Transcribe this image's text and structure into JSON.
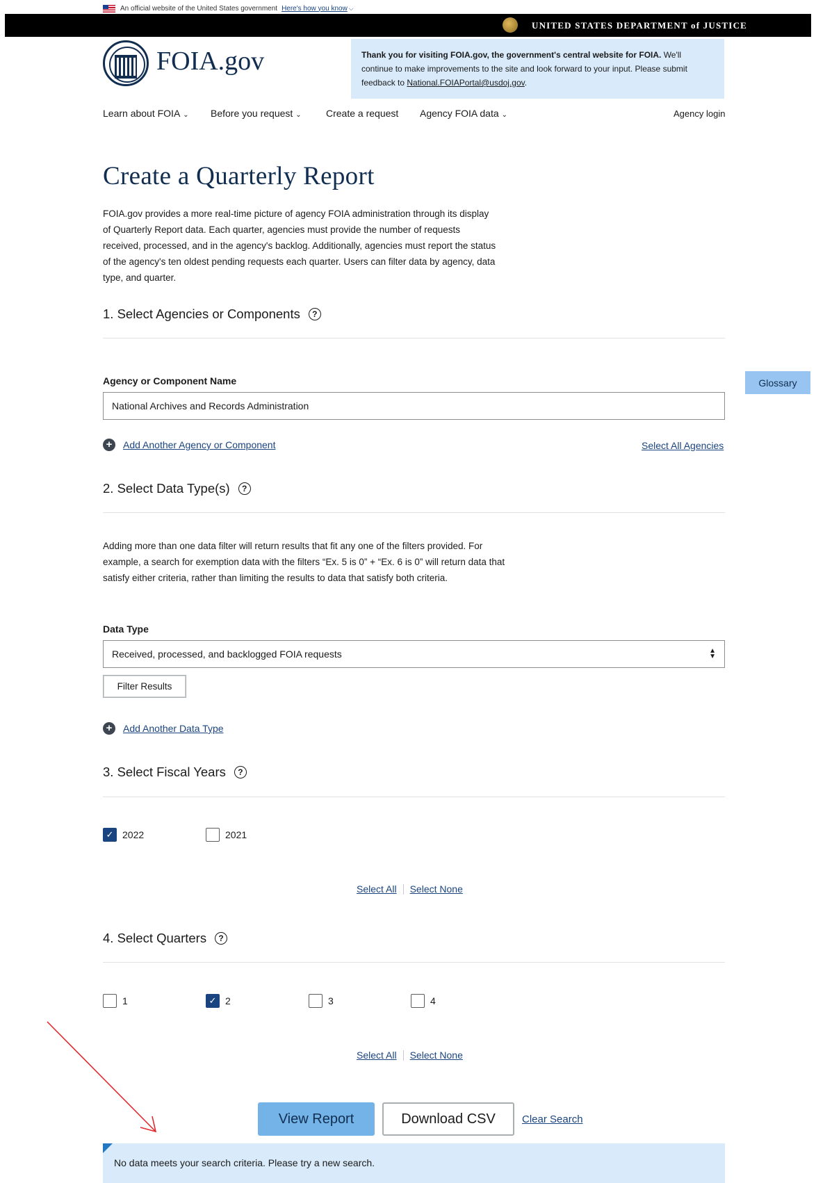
{
  "gov_banner": {
    "text": "An official website of the United States government",
    "link": "Here's how you know"
  },
  "doj_bar": {
    "text": "UNITED STATES DEPARTMENT of JUSTICE"
  },
  "header": {
    "logo_text": "FOIA.gov",
    "notice_bold": "Thank you for visiting FOIA.gov, the government's central website for FOIA.",
    "notice_text": " We'll continue to make improvements to the site and look forward to your input. Please submit feedback to ",
    "notice_email": "National.FOIAPortal@usdoj.gov",
    "notice_end": "."
  },
  "nav": {
    "learn": "Learn about FOIA",
    "before": "Before you request",
    "create": "Create a request",
    "agency_data": "Agency FOIA data",
    "login": "Agency login"
  },
  "page": {
    "title": "Create a Quarterly Report",
    "intro": "FOIA.gov provides a more real-time picture of agency FOIA administration through its display of Quarterly Report data. Each quarter, agencies must provide the number of requests received, processed, and in the agency's backlog. Additionally, agencies must report the status of the agency's ten oldest pending requests each quarter. Users can filter data by agency, data type, and quarter."
  },
  "section1": {
    "title": "1. Select Agencies or Components",
    "field_label": "Agency or Component Name",
    "field_value": "National Archives and Records Administration",
    "add_link": "Add Another Agency or Component",
    "select_all": "Select All Agencies"
  },
  "section2": {
    "title": "2. Select Data Type(s)",
    "description": "Adding more than one data filter will return results that fit any one of the filters provided. For example, a search for exemption data with the filters “Ex. 5 is 0” + “Ex. 6 is 0” will return data that satisfy either criteria, rather than limiting the results to data that satisfy both criteria.",
    "field_label": "Data Type",
    "selected": "Received, processed, and backlogged FOIA requests",
    "filter_button": "Filter Results",
    "add_link": "Add Another Data Type"
  },
  "section3": {
    "title": "3. Select Fiscal Years",
    "years": [
      {
        "label": "2022",
        "checked": true
      },
      {
        "label": "2021",
        "checked": false
      }
    ],
    "select_all": "Select All",
    "select_none": "Select None"
  },
  "section4": {
    "title": "4. Select Quarters",
    "quarters": [
      {
        "label": "1",
        "checked": false
      },
      {
        "label": "2",
        "checked": true
      },
      {
        "label": "3",
        "checked": false
      },
      {
        "label": "4",
        "checked": false
      }
    ],
    "select_all": "Select All",
    "select_none": "Select None"
  },
  "actions": {
    "view_report": "View Report",
    "download_csv": "Download CSV",
    "clear_search": "Clear Search"
  },
  "alert": {
    "message": "No data meets your search criteria. Please try a new search."
  },
  "glossary": {
    "label": "Glossary"
  },
  "colors": {
    "primary": "#1a4480",
    "accent_button": "#73b3e7",
    "info_bg": "#d9ebfa",
    "annotation_arrow": "#e0282e"
  }
}
